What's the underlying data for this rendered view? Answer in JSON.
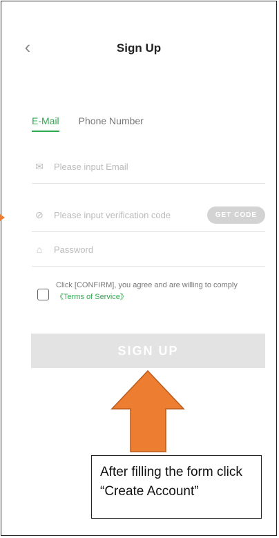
{
  "header": {
    "back_icon": "chevron-left-icon",
    "title": "Sign Up"
  },
  "tabs": [
    {
      "label": "E-Mail",
      "active": true
    },
    {
      "label": "Phone Number",
      "active": false
    }
  ],
  "form": {
    "email": {
      "icon": "mail-icon",
      "placeholder": "Please input Email",
      "value": ""
    },
    "code": {
      "icon": "shield-check-icon",
      "placeholder": "Please input verification code",
      "value": "",
      "button": "GET CODE"
    },
    "password": {
      "icon": "lock-icon",
      "placeholder": "Password",
      "value": ""
    },
    "agreement": {
      "text": "Click [CONFIRM], you agree and are willing to comply ",
      "link": "《Terms of Service》",
      "checked": false
    },
    "submit": "SIGN UP"
  },
  "annotation": {
    "callout_text": "After filling the form click “Create Account”",
    "arrow_color": "#ed7d31"
  },
  "colors": {
    "accent": "#2fa84f",
    "button_disabled": "#e3e3e3"
  }
}
